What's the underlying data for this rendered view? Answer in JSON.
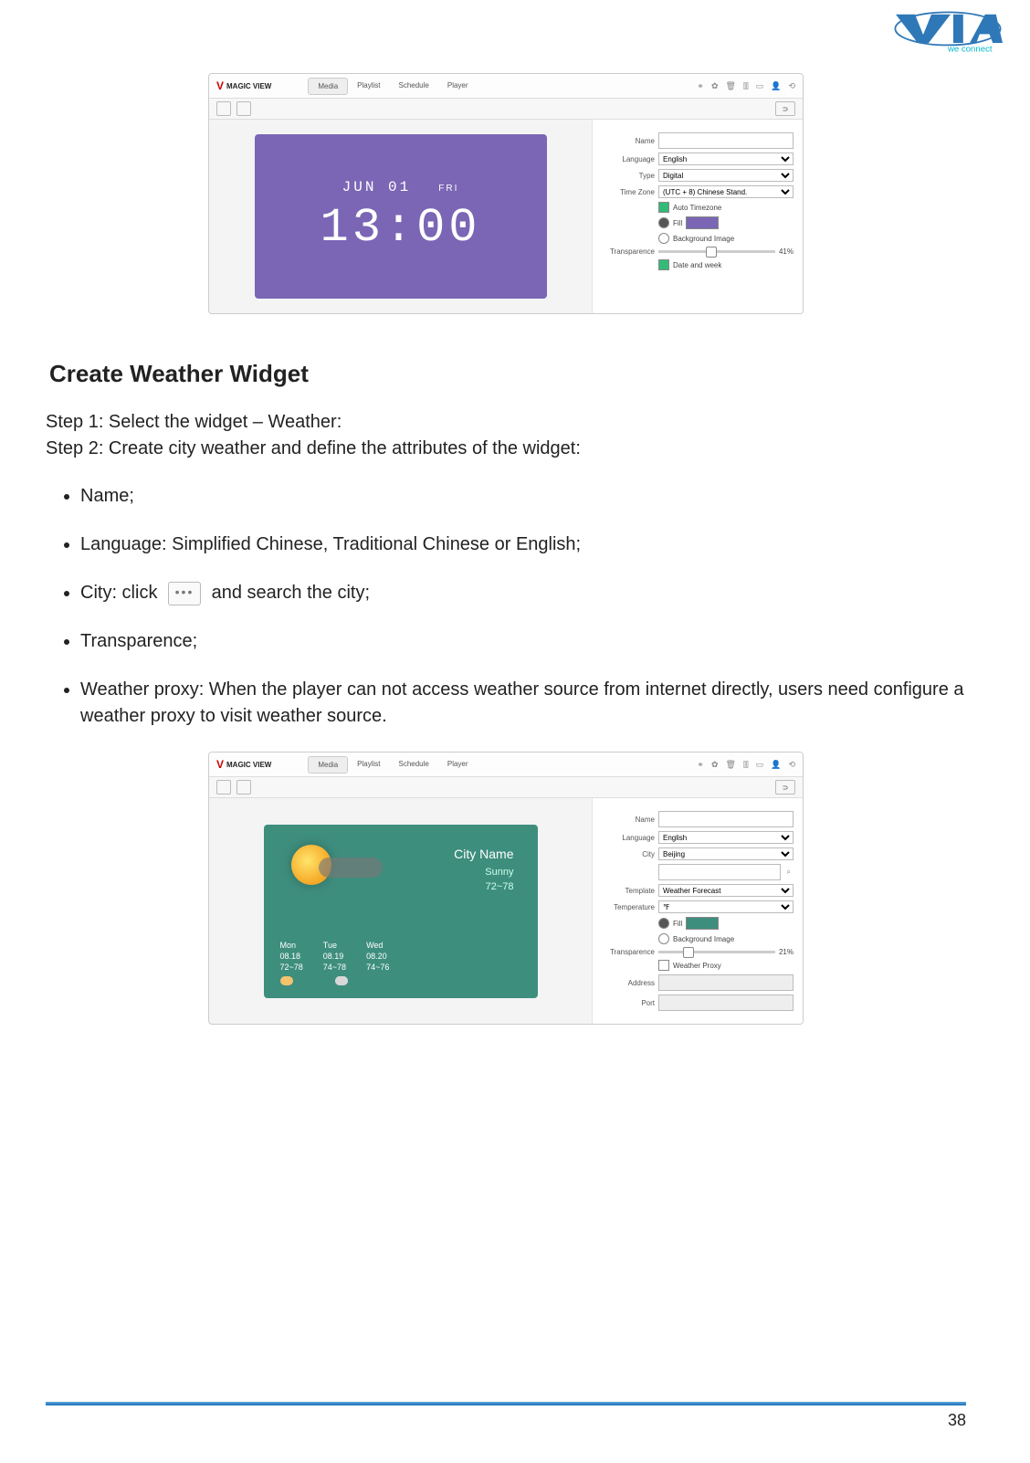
{
  "header_logo_tagline": "we connect",
  "app": {
    "brand": "MAGIC VIEW",
    "tabs": [
      "Media",
      "Playlist",
      "Schedule",
      "Player"
    ],
    "active_tab": "Media",
    "toolbar_icons": [
      "link-icon",
      "gear-icon",
      "trash-icon",
      "chart-icon",
      "screen-icon",
      "user-icon",
      "logout-icon"
    ]
  },
  "clock_panel": {
    "date": "JUN 01",
    "weekday": "FRI",
    "time": "13:00",
    "fields": {
      "name_label": "Name",
      "name_value": "",
      "language_label": "Language",
      "language_value": "English",
      "type_label": "Type",
      "type_value": "Digital",
      "timezone_label": "Time Zone",
      "timezone_value": "(UTC + 8) Chinese Stand.",
      "auto_tz_label": "Auto Timezone",
      "auto_tz_checked": true,
      "fill_label": "Fill",
      "fill_selected": true,
      "bgimg_label": "Background Image",
      "bgimg_selected": false,
      "transparence_label": "Transparence",
      "transparence_value": "41%",
      "transparence_pct": 41,
      "dateweek_label": "Date and week",
      "dateweek_checked": true
    }
  },
  "doc": {
    "heading": "Create Weather Widget",
    "step1": "Step 1: Select the widget – Weather:",
    "step2": "Step 2: Create city weather and define the attributes of the widget:",
    "bullets": {
      "b1": "Name;",
      "b2": "Language: Simplified Chinese, Traditional Chinese or English;",
      "b3_pre": "City: click",
      "b3_post": "and search the city;",
      "b4": "Transparence;",
      "b5": "Weather proxy: When the player can not access weather source from internet directly, users need configure a weather proxy to visit weather source."
    }
  },
  "weather_panel": {
    "preview": {
      "city": "City Name",
      "condition": "Sunny",
      "temp_range": "72~78",
      "forecast": [
        {
          "dow": "Mon",
          "date": "08.18",
          "range": "72~78"
        },
        {
          "dow": "Tue",
          "date": "08.19",
          "range": "74~78"
        },
        {
          "dow": "Wed",
          "date": "08.20",
          "range": "74~76"
        }
      ]
    },
    "fields": {
      "name_label": "Name",
      "name_value": "",
      "language_label": "Language",
      "language_value": "English",
      "city_label": "City",
      "city_value": "Beijing",
      "template_label": "Template",
      "template_value": "Weather Forecast",
      "temperature_label": "Temperature",
      "temperature_value": "℉",
      "fill_label": "Fill",
      "fill_selected": true,
      "bgimg_label": "Background Image",
      "bgimg_selected": false,
      "transparence_label": "Transparence",
      "transparence_value": "21%",
      "transparence_pct": 21,
      "proxy_label": "Weather Proxy",
      "proxy_checked": false,
      "address_label": "Address",
      "address_value": "",
      "port_label": "Port",
      "port_value": ""
    }
  },
  "page_number": "38"
}
